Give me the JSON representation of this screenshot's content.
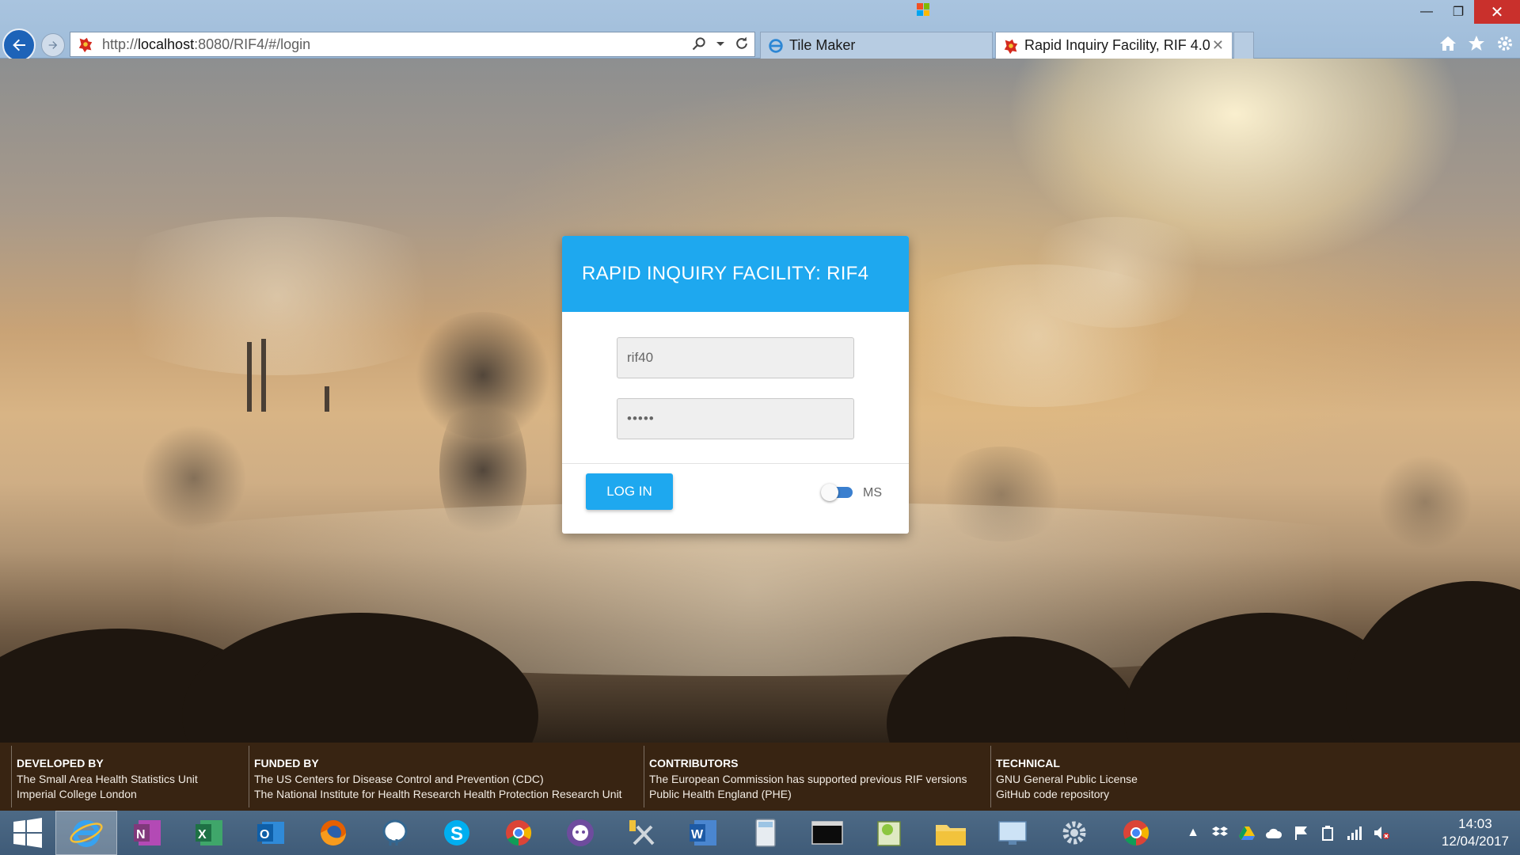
{
  "browser": {
    "address_url_prefix": "http://",
    "address_url_host": "localhost",
    "address_url_rest": ":8080/RIF4/#/login",
    "tabs": [
      {
        "label": "Tile Maker",
        "active": false
      },
      {
        "label": "Rapid Inquiry Facility, RIF 4.0",
        "active": true
      }
    ],
    "tab_close": "✕",
    "win_minimize": "—",
    "win_restore": "❐",
    "win_close": "✕"
  },
  "login": {
    "title": "RAPID INQUIRY FACILITY: RIF4",
    "username_value": "rif40",
    "password_value": "•••••",
    "login_button": "LOG IN",
    "toggle_label": "MS"
  },
  "footer": {
    "columns": [
      {
        "heading": "DEVELOPED BY",
        "lines": [
          "The Small Area Health Statistics Unit",
          "Imperial College London"
        ]
      },
      {
        "heading": "FUNDED BY",
        "lines": [
          "The US Centers for Disease Control and Prevention (CDC)",
          "The National Institute for Health Research Health Protection Research Unit"
        ]
      },
      {
        "heading": "CONTRIBUTORS",
        "lines": [
          "The European Commission has supported previous RIF versions",
          "Public Health England (PHE)"
        ]
      },
      {
        "heading": "TECHNICAL",
        "lines": [
          "GNU General Public License",
          "GitHub code repository"
        ]
      }
    ]
  },
  "taskbar": {
    "apps": [
      "windows-start",
      "internet-explorer",
      "onenote",
      "excel",
      "outlook",
      "firefox",
      "postgresql",
      "skype",
      "chrome",
      "github",
      "tools",
      "word",
      "calculator",
      "command-prompt",
      "notepad",
      "file-explorer",
      "remote-desktop",
      "settings",
      "chrome"
    ],
    "clock_time": "14:03",
    "clock_date": "12/04/2017"
  },
  "colors": {
    "accent": "#1ea8ef",
    "toggle": "#3a7fcf",
    "footer_bg": "#34200e",
    "taskbar_bg": "#456380"
  }
}
